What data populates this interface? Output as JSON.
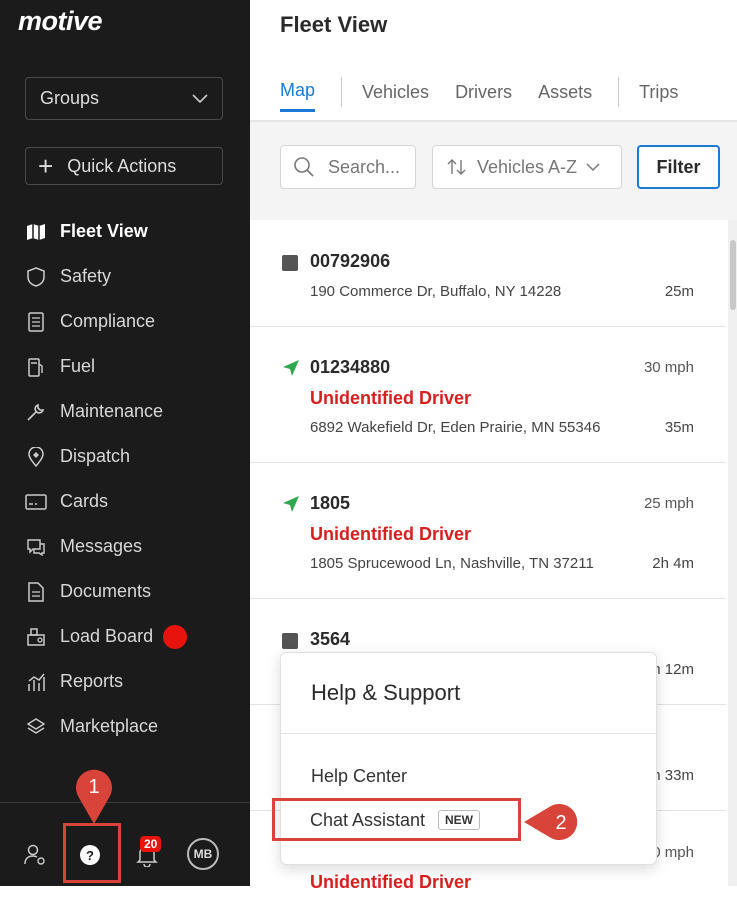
{
  "sidebar": {
    "logo": "motive",
    "groups_label": "Groups",
    "quick_actions_label": "Quick Actions",
    "items": [
      {
        "label": "Fleet View",
        "icon": "map-icon",
        "active": true
      },
      {
        "label": "Safety",
        "icon": "shield-icon"
      },
      {
        "label": "Compliance",
        "icon": "document-list-icon"
      },
      {
        "label": "Fuel",
        "icon": "fuel-pump-icon"
      },
      {
        "label": "Maintenance",
        "icon": "wrench-icon"
      },
      {
        "label": "Dispatch",
        "icon": "dispatch-pin-icon"
      },
      {
        "label": "Cards",
        "icon": "card-icon"
      },
      {
        "label": "Messages",
        "icon": "chat-icon"
      },
      {
        "label": "Documents",
        "icon": "file-icon"
      },
      {
        "label": "Load Board",
        "icon": "load-board-icon"
      },
      {
        "label": "Reports",
        "icon": "chart-icon"
      },
      {
        "label": "Marketplace",
        "icon": "layers-icon"
      }
    ],
    "help_icon_glyph": "?",
    "notification_count": "20",
    "avatar_initials": "MB"
  },
  "markers": {
    "one": "1",
    "two": "2"
  },
  "main": {
    "title": "Fleet View",
    "tabs": [
      "Map",
      "Vehicles",
      "Drivers",
      "Assets",
      "Trips"
    ],
    "search_placeholder": "Search...",
    "sort_label": "Vehicles A-Z",
    "filter_label": "Filter"
  },
  "vehicles": [
    {
      "name": "00792906",
      "status": "stopped",
      "address": "190 Commerce Dr, Buffalo, NY 14228",
      "time": "25m"
    },
    {
      "name": "01234880",
      "status": "moving",
      "speed": "30 mph",
      "driver": "Unidentified Driver",
      "address": "6892 Wakefield Dr, Eden Prairie, MN 55346",
      "time": "35m"
    },
    {
      "name": "1805",
      "status": "moving",
      "speed": "25 mph",
      "driver": "Unidentified Driver",
      "address": "1805 Sprucewood Ln, Nashville, TN 37211",
      "time": "2h 4m"
    },
    {
      "name": "3564",
      "status": "stopped",
      "time": "h 12m"
    },
    {
      "time": "h 33m"
    },
    {
      "speed": "0 mph",
      "driver": "Unidentified Driver"
    }
  ],
  "popup": {
    "title": "Help & Support",
    "help_center": "Help Center",
    "chat_assistant": "Chat Assistant",
    "new_badge": "NEW"
  },
  "colors": {
    "accent": "#1a7ad6",
    "alert": "#d61f1f",
    "annotation": "#d8433a",
    "moving": "#2fa84f"
  }
}
